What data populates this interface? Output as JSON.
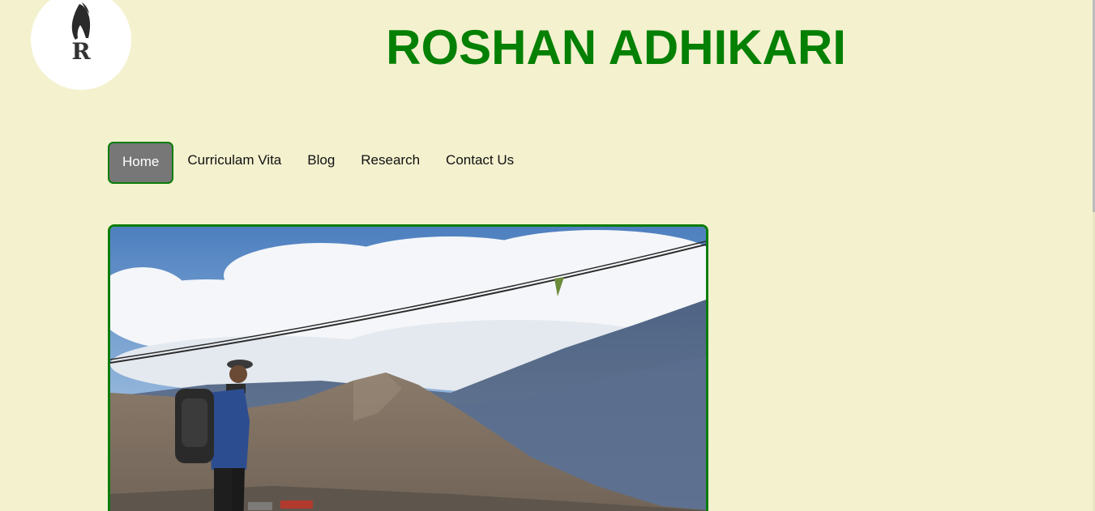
{
  "logo": {
    "letter": "R",
    "icon": "hair-silhouette-icon"
  },
  "header": {
    "title": "ROSHAN ADHIKARI"
  },
  "nav": {
    "items": [
      {
        "label": "Home",
        "active": true
      },
      {
        "label": "Curriculam Vita",
        "active": false
      },
      {
        "label": "Blog",
        "active": false
      },
      {
        "label": "Research",
        "active": false
      },
      {
        "label": "Contact Us",
        "active": false
      }
    ]
  },
  "hero": {
    "alt": "Hiker with backpack overlooking mountains and clouds"
  },
  "colors": {
    "background": "#f4f1cf",
    "title": "#048004",
    "accent_border": "#0a7d0a",
    "active_nav_bg": "#777777"
  }
}
